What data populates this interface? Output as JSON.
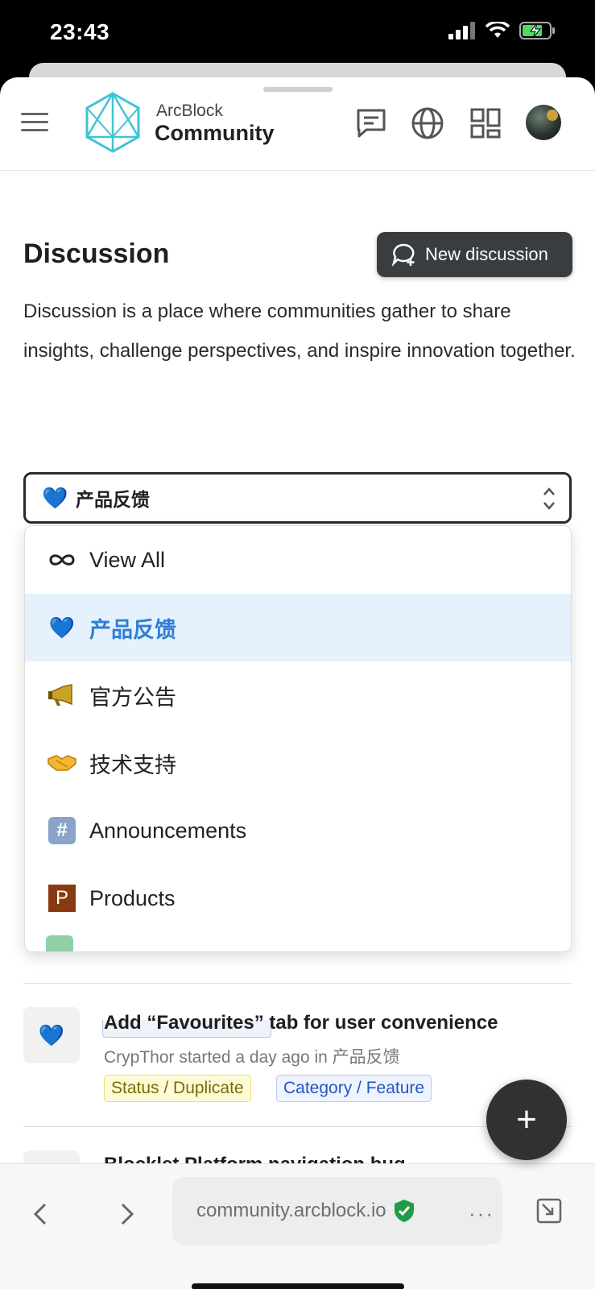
{
  "status": {
    "time": "23:43"
  },
  "header": {
    "brand_top": "ArcBlock",
    "brand_bottom": "Community"
  },
  "page": {
    "title": "Discussion",
    "new_discussion_label": "New discussion",
    "description": "Discussion is a place where communities gather to share insights, challenge perspectives, and inspire innovation together."
  },
  "board_select": {
    "emoji": "💙",
    "value": "产品反馈"
  },
  "dropdown": {
    "items": [
      {
        "icon": "infinity-icon",
        "label": "View All"
      },
      {
        "icon": "blue-heart-icon",
        "label": "产品反馈",
        "selected": true
      },
      {
        "icon": "megaphone-icon",
        "label": "官方公告"
      },
      {
        "icon": "handshake-icon",
        "label": "技术支持"
      },
      {
        "icon": "hash-icon",
        "label": "Announcements"
      },
      {
        "icon": "p-letter-icon",
        "label": "Products"
      }
    ]
  },
  "posts": [
    {
      "title": "Add “Favourites” tab for user convenience",
      "meta": "CrypThor started a day ago in 产品反馈",
      "tags": [
        "Status / Duplicate",
        "Category / Feature"
      ]
    },
    {
      "title": "Blocklet Platform navigation bug"
    }
  ],
  "browser": {
    "url": "community.arcblock.io"
  },
  "colors": {
    "accent": "#2f7ed8",
    "selected_bg": "#e5f1fc",
    "button_dark": "#3a3d40"
  }
}
